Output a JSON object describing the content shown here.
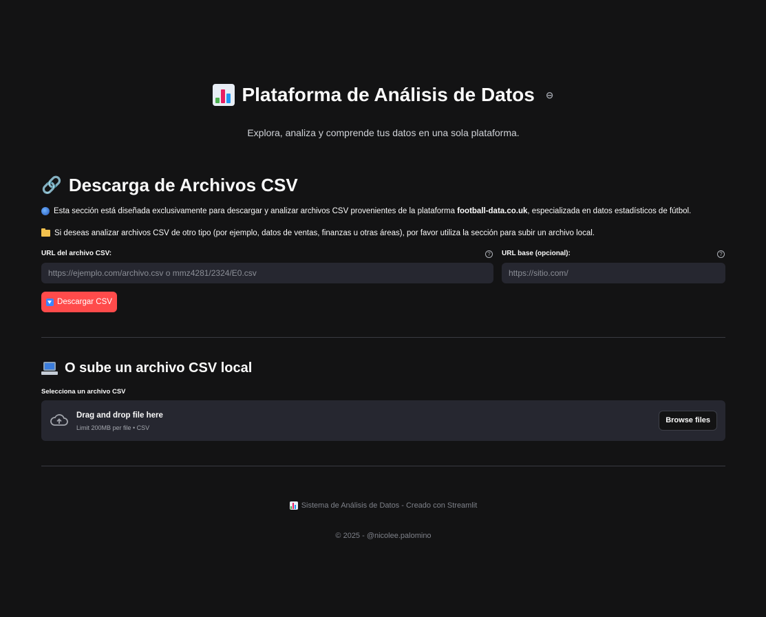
{
  "hero": {
    "title": "Plataforma de Análisis de Datos",
    "subtitle": "Explora, analiza y comprende tus datos en una sola plataforma."
  },
  "download_section": {
    "title": "Descarga de Archivos CSV",
    "info1_prefix": "Esta sección está diseñada exclusivamente para descargar y analizar archivos CSV provenientes de la plataforma ",
    "info1_bold": "football-data.co.uk",
    "info1_suffix": ", especializada en datos estadísticos de fútbol.",
    "info2": "Si deseas analizar archivos CSV de otro tipo (por ejemplo, datos de ventas, finanzas u otras áreas), por favor utiliza la sección para subir un archivo local.",
    "url_label": "URL del archivo CSV:",
    "url_placeholder": "https://ejemplo.com/archivo.csv o mmz4281/2324/E0.csv",
    "base_label": "URL base (opcional):",
    "base_placeholder": "https://sitio.com/",
    "download_button": "Descargar CSV"
  },
  "upload_section": {
    "title": "O sube un archivo CSV local",
    "field_label": "Selecciona un archivo CSV",
    "drop_title": "Drag and drop file here",
    "drop_sub": "Limit 200MB per file • CSV",
    "browse_button": "Browse files"
  },
  "footer": {
    "line1": "Sistema de Análisis de Datos - Creado con Streamlit",
    "line2": "© 2025 - @nicolee.palomino"
  },
  "colors": {
    "background": "#131314",
    "input_bg": "#262730",
    "primary_button": "#ff4b4b"
  },
  "icons": [
    "bar-chart-icon",
    "link-icon",
    "globe-icon",
    "folder-icon",
    "help-icon",
    "download-arrow-icon",
    "laptop-icon",
    "cloud-upload-icon"
  ]
}
